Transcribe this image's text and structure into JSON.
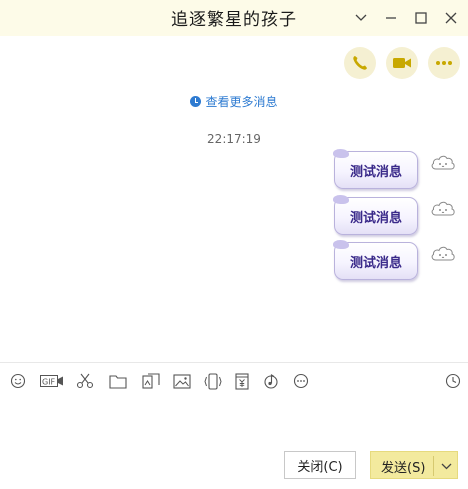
{
  "window": {
    "title": "追逐繁星的孩子",
    "controls": [
      "chevron-down-icon",
      "minimize-icon",
      "maximize-icon",
      "close-icon"
    ]
  },
  "header_actions": [
    "phone-icon",
    "video-camera-icon",
    "more-icon"
  ],
  "chat": {
    "more_messages": "查看更多消息",
    "timestamp": "22:17:19",
    "messages": [
      {
        "text": "测试消息",
        "status_icon": "cloud-avatar-icon"
      },
      {
        "text": "测试消息",
        "status_icon": "cloud-avatar-icon"
      },
      {
        "text": "测试消息",
        "status_icon": "cloud-avatar-icon"
      }
    ]
  },
  "toolbar": {
    "icons": [
      "emoji-icon",
      "gif-icon",
      "scissors-icon",
      "folder-icon",
      "image-template-icon",
      "picture-icon",
      "shake-icon",
      "red-packet-icon",
      "music-icon",
      "more-options-icon",
      "history-clock-icon"
    ],
    "gif_label": "GIF"
  },
  "footer": {
    "close_label": "关闭(C)",
    "send_label": "发送(S)"
  },
  "colors": {
    "titlebar_bg": "#fdfbe8",
    "accent_icon": "#c8a800",
    "send_bg": "#f3ea9e",
    "link_blue": "#2e7bd1",
    "bubble_text": "#3a2a8a"
  }
}
